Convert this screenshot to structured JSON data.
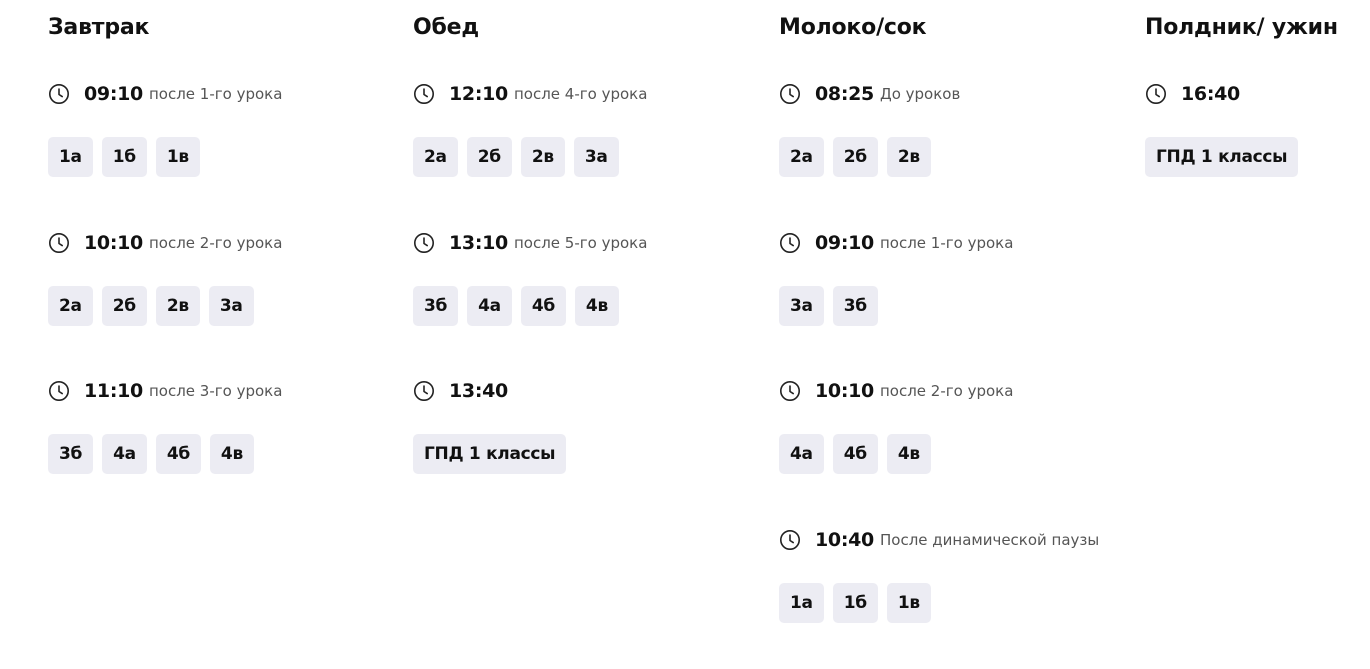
{
  "columns": [
    {
      "title": "Завтрак",
      "slots": [
        {
          "time": "09:10",
          "note": "после 1-го урока",
          "classes": [
            "1а",
            "1б",
            "1в"
          ]
        },
        {
          "time": "10:10",
          "note": "после 2-го урока",
          "classes": [
            "2а",
            "2б",
            "2в",
            "3а"
          ]
        },
        {
          "time": "11:10",
          "note": "после 3-го урока",
          "classes": [
            "3б",
            "4а",
            "4б",
            "4в"
          ]
        }
      ]
    },
    {
      "title": "Обед",
      "slots": [
        {
          "time": "12:10",
          "note": "после 4-го урока",
          "classes": [
            "2а",
            "2б",
            "2в",
            "3а"
          ]
        },
        {
          "time": "13:10",
          "note": "после 5-го урока",
          "classes": [
            "3б",
            "4а",
            "4б",
            "4в"
          ]
        },
        {
          "time": "13:40",
          "note": "",
          "classes": [
            "ГПД 1 классы"
          ]
        }
      ]
    },
    {
      "title": "Молоко/сок",
      "slots": [
        {
          "time": "08:25",
          "note": "До уроков",
          "classes": [
            "2а",
            "2б",
            "2в"
          ]
        },
        {
          "time": "09:10",
          "note": "после 1-го урока",
          "classes": [
            "3а",
            "3б"
          ]
        },
        {
          "time": "10:10",
          "note": "после 2-го урока",
          "classes": [
            "4а",
            "4б",
            "4в"
          ]
        },
        {
          "time": "10:40",
          "note": "После динамической паузы",
          "classes": [
            "1а",
            "1б",
            "1в"
          ]
        }
      ]
    },
    {
      "title": "Полдник/ ужин",
      "slots": [
        {
          "time": "16:40",
          "note": "",
          "classes": [
            "ГПД 1 классы"
          ]
        }
      ]
    }
  ],
  "icons": {
    "clock": "clock-icon"
  },
  "colors": {
    "tag_bg": "#ececf3",
    "text": "#111111",
    "note": "#555555"
  }
}
